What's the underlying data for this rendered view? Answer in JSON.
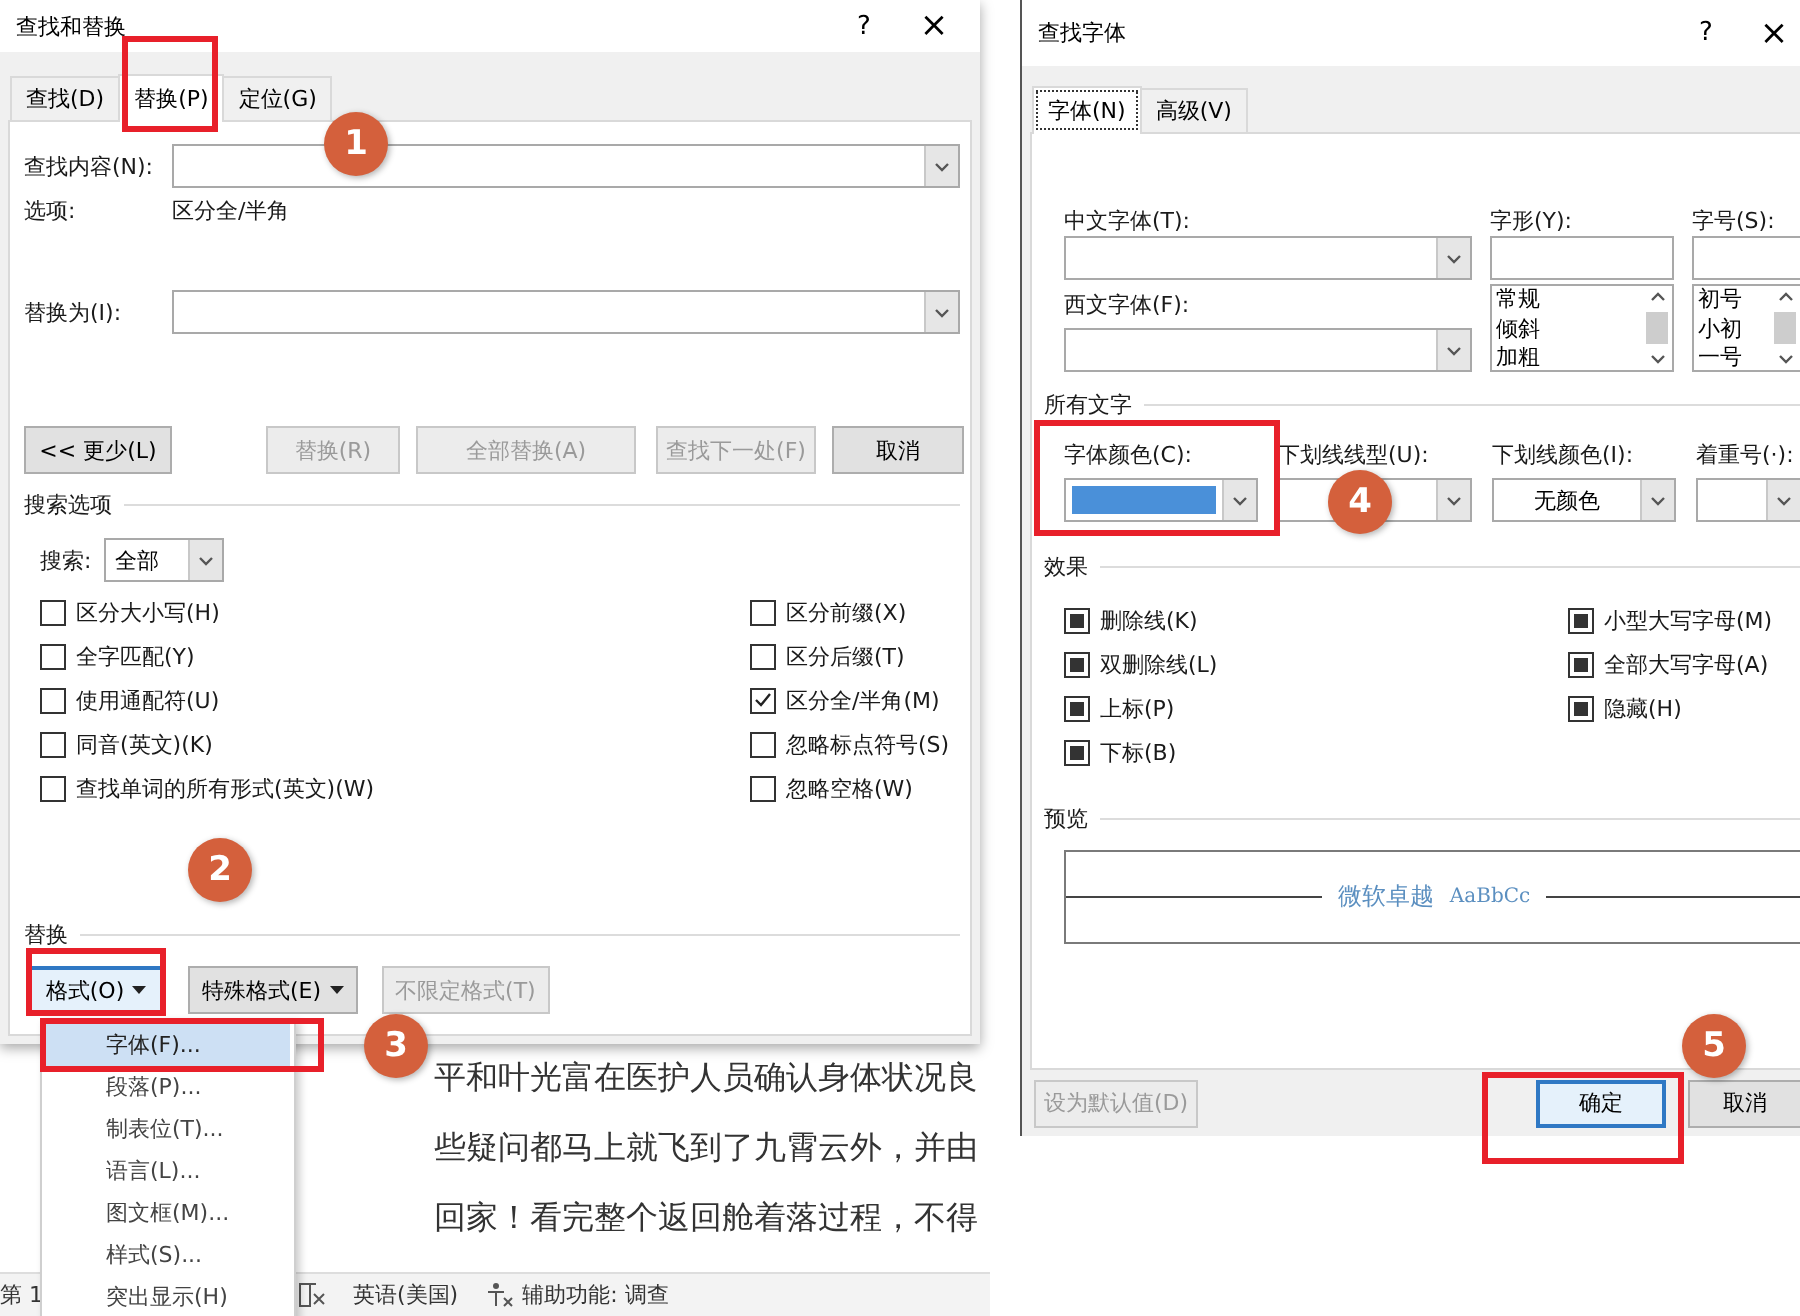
{
  "find_replace_dialog": {
    "title": "查找和替换",
    "help": "?",
    "close": "×",
    "tabs": [
      {
        "label": "查找(D)",
        "selected": false
      },
      {
        "label": "替换(P)",
        "selected": true
      },
      {
        "label": "定位(G)",
        "selected": false
      }
    ],
    "find_label": "查找内容(N):",
    "options_label": "选项:",
    "options_value": "区分全/半角",
    "replace_label": "替换为(I):",
    "buttons": [
      {
        "label": "<< 更少(L)",
        "disabled": false
      },
      {
        "label": "替换(R)",
        "disabled": true
      },
      {
        "label": "全部替换(A)",
        "disabled": true
      },
      {
        "label": "查找下一处(F)",
        "disabled": true
      },
      {
        "label": "取消",
        "disabled": false
      }
    ],
    "search_options_title": "搜索选项",
    "search_label": "搜索:",
    "search_value": "全部",
    "options_left": [
      {
        "label": "区分大小写(H)",
        "checked": false
      },
      {
        "label": "全字匹配(Y)",
        "checked": false
      },
      {
        "label": "使用通配符(U)",
        "checked": false
      },
      {
        "label": "同音(英文)(K)",
        "checked": false
      },
      {
        "label": "查找单词的所有形式(英文)(W)",
        "checked": false
      }
    ],
    "options_right": [
      {
        "label": "区分前缀(X)",
        "checked": false
      },
      {
        "label": "区分后缀(T)",
        "checked": false
      },
      {
        "label": "区分全/半角(M)",
        "checked": true
      },
      {
        "label": "忽略标点符号(S)",
        "checked": false
      },
      {
        "label": "忽略空格(W)",
        "checked": false
      }
    ],
    "replace_group_title": "替换",
    "format_buttons": [
      {
        "label": "格式(O)",
        "dropdown": true,
        "disabled": false,
        "focused": true
      },
      {
        "label": "特殊格式(E)",
        "dropdown": true,
        "disabled": false,
        "focused": false
      },
      {
        "label": "不限定格式(T)",
        "dropdown": false,
        "disabled": true,
        "focused": false
      }
    ]
  },
  "format_menu": {
    "items": [
      {
        "label": "字体(F)...",
        "selected": true
      },
      {
        "label": "段落(P)...",
        "selected": false
      },
      {
        "label": "制表位(T)...",
        "selected": false
      },
      {
        "label": "语言(L)...",
        "selected": false
      },
      {
        "label": "图文框(M)...",
        "selected": false
      },
      {
        "label": "样式(S)...",
        "selected": false
      },
      {
        "label": "突出显示(H)",
        "selected": false
      }
    ]
  },
  "document": {
    "lines": [
      "平和叶光富在医护人员确认身体状况良",
      "些疑问都马上就飞到了九霄云外，并由",
      "回家！看完整个返回舱着落过程，不得"
    ]
  },
  "status_bar": {
    "page": "第 1",
    "language": "英语(美国)",
    "accessibility": "辅助功能: 调查"
  },
  "font_dialog": {
    "title": "查找字体",
    "help": "?",
    "close": "×",
    "tabs": [
      {
        "label": "字体(N)",
        "selected": true
      },
      {
        "label": "高级(V)",
        "selected": false
      }
    ],
    "chinese_font_label": "中文字体(T):",
    "western_font_label": "西文字体(F):",
    "style_label": "字形(Y):",
    "styles": [
      "常规",
      "倾斜",
      "加粗"
    ],
    "size_label": "字号(S):",
    "sizes": [
      "初号",
      "小初",
      "一号"
    ],
    "all_text_title": "所有文字",
    "font_color_label": "字体颜色(C):",
    "font_color": {
      "color": "#4a90d9"
    },
    "underline_style_label": "下划线线型(U):",
    "underline_color_label": "下划线颜色(I):",
    "underline_color_value": "无颜色",
    "emphasis_label": "着重号(·):",
    "effects_title": "效果",
    "effects_left": [
      {
        "label": "删除线(K)",
        "mixed": true
      },
      {
        "label": "双删除线(L)",
        "mixed": true
      },
      {
        "label": "上标(P)",
        "mixed": true
      },
      {
        "label": "下标(B)",
        "mixed": true
      }
    ],
    "effects_right": [
      {
        "label": "小型大写字母(M)",
        "mixed": true
      },
      {
        "label": "全部大写字母(A)",
        "mixed": true
      },
      {
        "label": "隐藏(H)",
        "mixed": true
      }
    ],
    "preview_title": "预览",
    "preview_text": "微软卓越",
    "preview_latin": "AaBbCc",
    "buttons": [
      {
        "label": "设为默认值(D)",
        "disabled": true,
        "default": false
      },
      {
        "label": "确定",
        "disabled": false,
        "default": true
      },
      {
        "label": "取消",
        "disabled": false,
        "default": false
      }
    ]
  },
  "annotations": [
    {
      "kind": "frame"
    },
    {
      "kind": "frame"
    },
    {
      "kind": "frame"
    },
    {
      "kind": "frame"
    },
    {
      "kind": "frame"
    },
    {
      "kind": "badge",
      "number": "1"
    },
    {
      "kind": "badge",
      "number": "2"
    },
    {
      "kind": "badge",
      "number": "3"
    },
    {
      "kind": "badge",
      "number": "4"
    },
    {
      "kind": "badge",
      "number": "5"
    }
  ]
}
